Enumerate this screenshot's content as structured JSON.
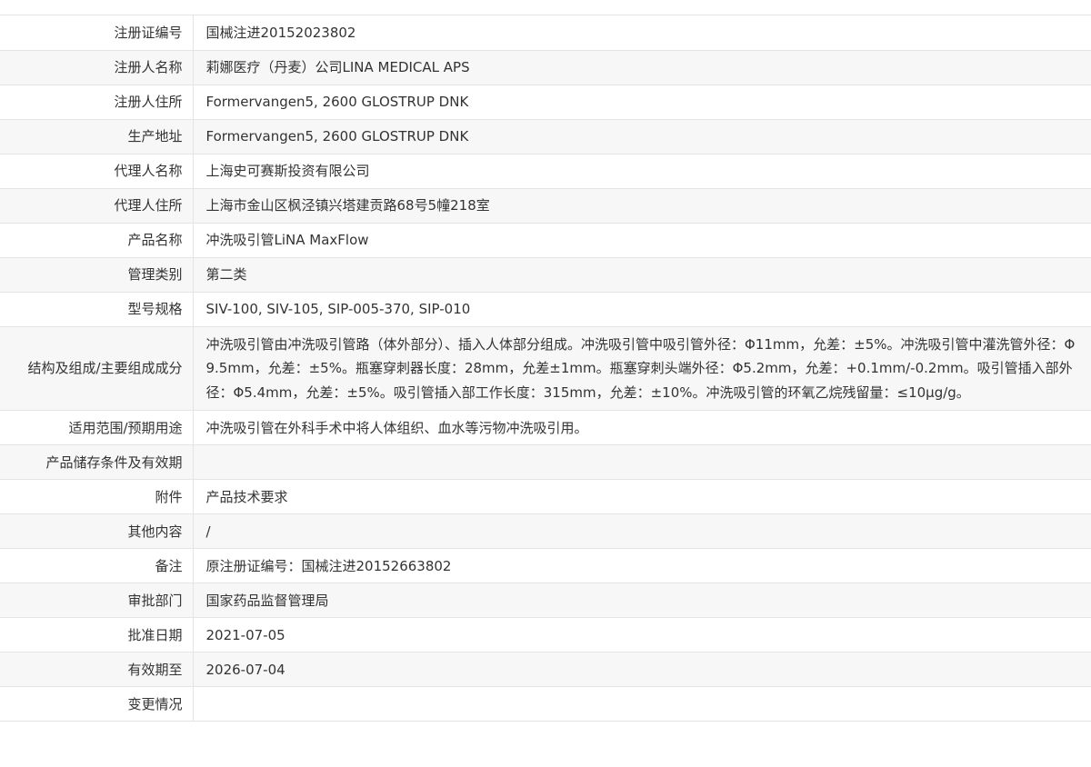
{
  "rows": [
    {
      "label": "注册证编号",
      "value": "国械注进20152023802"
    },
    {
      "label": "注册人名称",
      "value": "莉娜医疗（丹麦）公司LINA MEDICAL APS"
    },
    {
      "label": "注册人住所",
      "value": "Formervangen5, 2600 GLOSTRUP DNK"
    },
    {
      "label": "生产地址",
      "value": "Formervangen5, 2600 GLOSTRUP DNK"
    },
    {
      "label": "代理人名称",
      "value": "上海史可赛斯投资有限公司"
    },
    {
      "label": "代理人住所",
      "value": "上海市金山区枫泾镇兴塔建贡路68号5幢218室"
    },
    {
      "label": "产品名称",
      "value": "冲洗吸引管LiNA MaxFlow"
    },
    {
      "label": "管理类别",
      "value": "第二类"
    },
    {
      "label": "型号规格",
      "value": "SIV-100, SIV-105, SIP-005-370, SIP-010"
    },
    {
      "label": "结构及组成/主要组成成分",
      "value": "冲洗吸引管由冲洗吸引管路（体外部分）、插入人体部分组成。冲洗吸引管中吸引管外径：Φ11mm，允差：±5%。冲洗吸引管中灌洗管外径：Φ9.5mm，允差：±5%。瓶塞穿刺器长度：28mm，允差±1mm。瓶塞穿刺头端外径：Φ5.2mm，允差：+0.1mm/-0.2mm。吸引管插入部外径：Φ5.4mm，允差：±5%。吸引管插入部工作长度：315mm，允差：±10%。冲洗吸引管的环氧乙烷残留量：≤10μg/g。"
    },
    {
      "label": "适用范围/预期用途",
      "value": "冲洗吸引管在外科手术中将人体组织、血水等污物冲洗吸引用。"
    },
    {
      "label": "产品储存条件及有效期",
      "value": ""
    },
    {
      "label": "附件",
      "value": "产品技术要求"
    },
    {
      "label": "其他内容",
      "value": "/"
    },
    {
      "label": "备注",
      "value": "原注册证编号：国械注进20152663802"
    },
    {
      "label": "审批部门",
      "value": "国家药品监督管理局"
    },
    {
      "label": "批准日期",
      "value": "2021-07-05"
    },
    {
      "label": "有效期至",
      "value": "2026-07-04"
    },
    {
      "label": "变更情况",
      "value": ""
    }
  ]
}
